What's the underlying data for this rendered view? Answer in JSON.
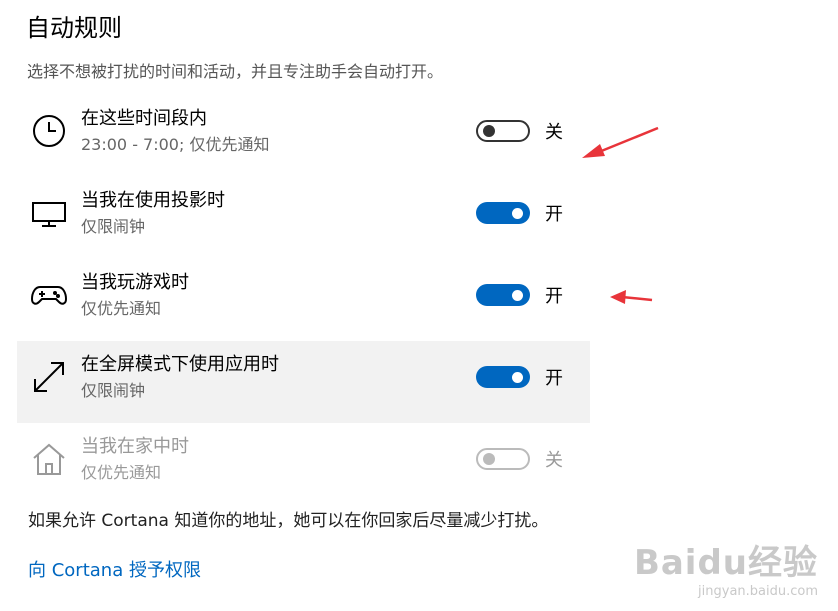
{
  "page": {
    "title": "自动规则",
    "description": "选择不想被打扰的时间和活动，并且专注助手会自动打开。"
  },
  "rules": [
    {
      "name": "在这些时间段内",
      "sub": "23:00 - 7:00; 仅优先通知",
      "state": "关",
      "icon": "clock-icon"
    },
    {
      "name": "当我在使用投影时",
      "sub": "仅限闹钟",
      "state": "开",
      "icon": "monitor-icon"
    },
    {
      "name": "当我玩游戏时",
      "sub": "仅优先通知",
      "state": "开",
      "icon": "gamepad-icon"
    },
    {
      "name": "在全屏模式下使用应用时",
      "sub": "仅限闹钟",
      "state": "开",
      "icon": "fullscreen-icon"
    },
    {
      "name": "当我在家中时",
      "sub": "仅优先通知",
      "state": "关",
      "icon": "home-icon"
    }
  ],
  "footer": {
    "text": "如果允许 Cortana 知道你的地址，她可以在你回家后尽量减少打扰。",
    "link": "向 Cortana 授予权限"
  },
  "watermark": {
    "main": "Baidu经验",
    "url": "jingyan.baidu.com"
  },
  "colors": {
    "accent": "#0067c0",
    "annotation_arrow": "#e8343a"
  }
}
